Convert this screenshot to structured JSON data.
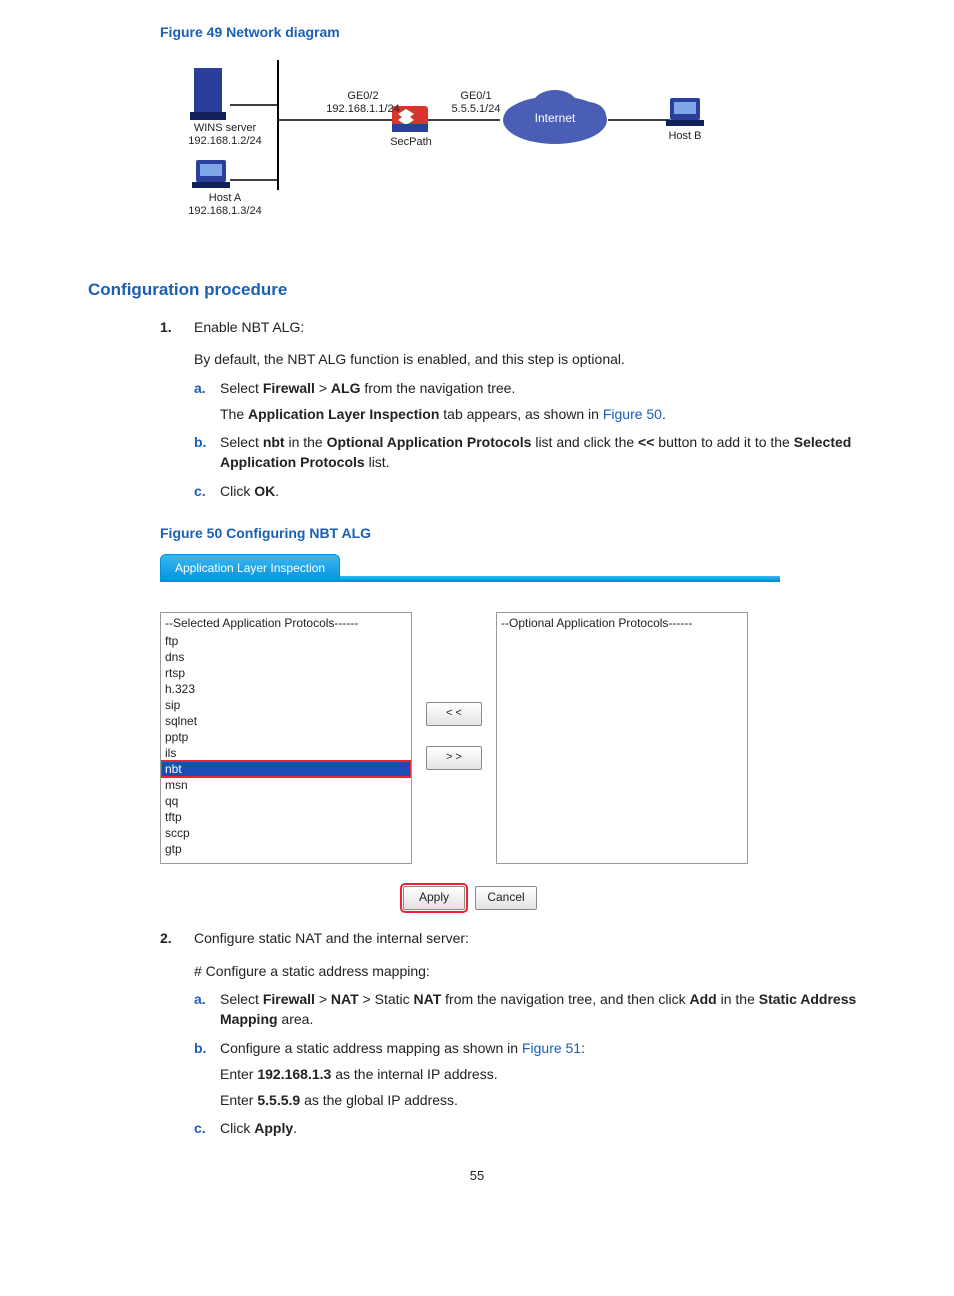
{
  "figure49": {
    "caption": "Figure 49 Network diagram",
    "labels": {
      "wins_server": "WINS server",
      "wins_ip": "192.168.1.2/24",
      "host_a": "Host A",
      "host_a_ip": "192.168.1.3/24",
      "ge02": "GE0/2",
      "ge02_ip": "192.168.1.1/24",
      "ge01": "GE0/1",
      "ge01_ip": "5.5.5.1/24",
      "secpath": "SecPath",
      "internet": "Internet",
      "host_b": "Host B"
    }
  },
  "section_heading": "Configuration procedure",
  "steps": {
    "s1_marker": "1.",
    "s1_text": "Enable NBT ALG:",
    "s1_note": "By default, the NBT ALG function is enabled, and this step is optional.",
    "s1a_marker": "a.",
    "s1a_pre": "Select ",
    "s1a_firewall": "Firewall",
    "s1a_gt": " > ",
    "s1a_alg": "ALG",
    "s1a_post": " from the navigation tree.",
    "s1a_line2_pre": "The ",
    "s1a_line2_bold": "Application Layer Inspection",
    "s1a_line2_mid": " tab appears, as shown in ",
    "s1a_line2_link": "Figure 50",
    "s1a_line2_end": ".",
    "s1b_marker": "b.",
    "s1b_pre": "Select ",
    "s1b_nbt": "nbt",
    "s1b_mid1": " in the ",
    "s1b_opt": "Optional Application Protocols",
    "s1b_mid2": " list and click the ",
    "s1b_btn": "<<",
    "s1b_mid3": " button to add it to the ",
    "s1b_sel": "Selected Application Protocols",
    "s1b_end": " list.",
    "s1c_marker": "c.",
    "s1c_pre": "Click ",
    "s1c_ok": "OK",
    "s1c_end": ".",
    "s2_marker": "2.",
    "s2_text": "Configure static NAT and the internal server:",
    "s2_note": "# Configure a static address mapping:",
    "s2a_marker": "a.",
    "s2a_pre": "Select ",
    "s2a_firewall": "Firewall",
    "s2a_gt1": " > ",
    "s2a_nat": "NAT",
    "s2a_gt2": " > Static ",
    "s2a_nat2": "NAT",
    "s2a_mid": " from the navigation tree, and then click ",
    "s2a_add": "Add",
    "s2a_mid2": " in the ",
    "s2a_sam": "Static Address Mapping",
    "s2a_end": " area.",
    "s2b_marker": "b.",
    "s2b_pre": "Configure a static address mapping as shown in ",
    "s2b_link": "Figure 51",
    "s2b_end": ":",
    "s2b_l2_pre": "Enter ",
    "s2b_l2_ip": "192.168.1.3",
    "s2b_l2_post": " as the internal IP address.",
    "s2b_l3_pre": "Enter ",
    "s2b_l3_ip": "5.5.5.9",
    "s2b_l3_post": " as the global IP address.",
    "s2c_marker": "c.",
    "s2c_pre": "Click ",
    "s2c_apply": "Apply",
    "s2c_end": "."
  },
  "figure50": {
    "caption": "Figure 50 Configuring NBT ALG",
    "tab": "Application Layer Inspection",
    "selected_header": "--Selected Application Protocols------",
    "optional_header": "--Optional Application Protocols------",
    "selected_items": [
      "ftp",
      "dns",
      "rtsp",
      "h.323",
      "sip",
      "sqlnet",
      "pptp",
      "ils",
      "nbt",
      "msn",
      "qq",
      "tftp",
      "sccp",
      "gtp"
    ],
    "highlight": "nbt",
    "btn_left": "< <",
    "btn_right": "> >",
    "apply": "Apply",
    "cancel": "Cancel"
  },
  "page_number": "55"
}
